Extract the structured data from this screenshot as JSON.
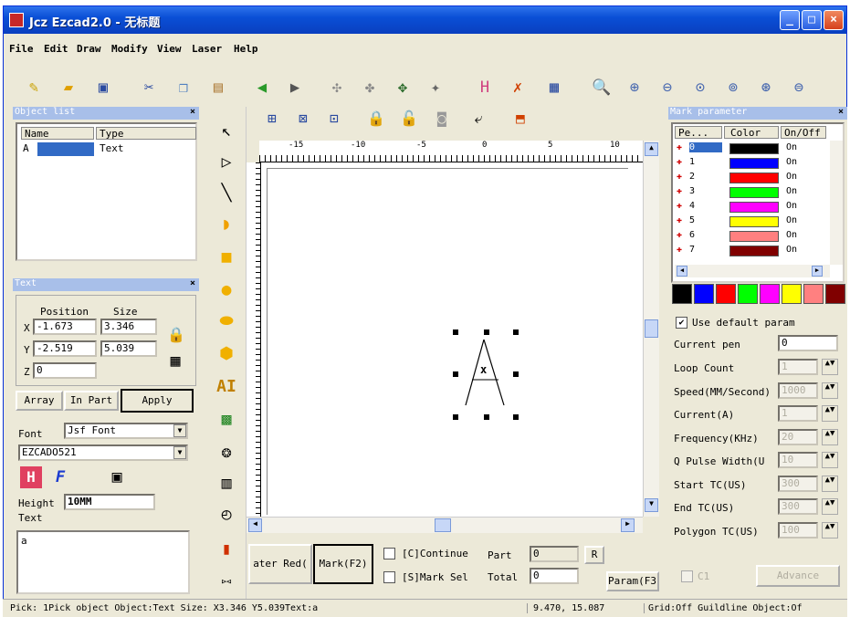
{
  "window": {
    "title": "Jcz Ezcad2.0 - 无标题"
  },
  "menu": [
    "File",
    "Edit",
    "Draw",
    "Modify",
    "View",
    "Laser",
    "Help"
  ],
  "object_list": {
    "title": "Object list",
    "headers": [
      "Name",
      "Type"
    ],
    "rows": [
      {
        "name": "A",
        "type": "Text"
      }
    ]
  },
  "text_panel": {
    "title": "Text",
    "position_label": "Position",
    "size_label": "Size",
    "x_label": "X",
    "y_label": "Y",
    "z_label": "Z",
    "x_pos": "-1.673",
    "x_size": "3.346",
    "y_pos": "-2.519",
    "y_size": "5.039",
    "z_pos": "0",
    "array": "Array",
    "in_part": "In Part",
    "apply": "Apply",
    "font_label": "Font",
    "font_type": "Jsf Font",
    "font_name": "EZCADO521",
    "height_label": "Height",
    "height_value": "10MM",
    "text_label": "Text",
    "text_value": "a"
  },
  "ruler": {
    "top_ticks": [
      "-15",
      "-10",
      "-5",
      "0",
      "5",
      "10"
    ]
  },
  "canvas": {
    "glyph": "A",
    "center_mark": "x"
  },
  "bottom_controls": {
    "red_button": "ater Red(",
    "mark_button": "Mark(F2)",
    "continue": "[C]Continue",
    "mark_sel": "[S]Mark Sel",
    "part_label": "Part",
    "total_label": "Total",
    "part_value": "0",
    "total_value": "0",
    "r_button": "R",
    "param_button": "Param(F3)"
  },
  "mark_param": {
    "title": "Mark parameter",
    "headers": [
      "Pe...",
      "Color",
      "On/Off"
    ],
    "pens": [
      {
        "id": "0",
        "color": "#000000",
        "state": "On"
      },
      {
        "id": "1",
        "color": "#0000ff",
        "state": "On"
      },
      {
        "id": "2",
        "color": "#ff0000",
        "state": "On"
      },
      {
        "id": "3",
        "color": "#00ff00",
        "state": "On"
      },
      {
        "id": "4",
        "color": "#ff00ff",
        "state": "On"
      },
      {
        "id": "5",
        "color": "#ffff00",
        "state": "On"
      },
      {
        "id": "6",
        "color": "#ff8080",
        "state": "On"
      },
      {
        "id": "7",
        "color": "#800000",
        "state": "On"
      }
    ],
    "palette": [
      "#000000",
      "#0000ff",
      "#ff0000",
      "#00ff00",
      "#ff00ff",
      "#ffff00",
      "#ff8080",
      "#800000"
    ],
    "use_default": "Use default param",
    "current_pen_label": "Current pen",
    "current_pen": "0",
    "params": [
      {
        "label": "Loop Count",
        "value": "1"
      },
      {
        "label": "Speed(MM/Second)",
        "value": "1000"
      },
      {
        "label": "Current(A)",
        "value": "1"
      },
      {
        "label": "Frequency(KHz)",
        "value": "20"
      },
      {
        "label": "Q Pulse Width(U",
        "value": "10"
      },
      {
        "label": "Start TC(US)",
        "value": "300"
      },
      {
        "label": "End TC(US)",
        "value": "300"
      },
      {
        "label": "Polygon TC(US)",
        "value": "100"
      }
    ],
    "checkbox_label": "C1",
    "advance": "Advance"
  },
  "status": {
    "pick": "Pick: 1Pick object Object:Text Size: X3.346 Y5.039Text:a",
    "coords": "9.470, 15.087",
    "grid": "Grid:Off  Guildline Object:Of"
  }
}
